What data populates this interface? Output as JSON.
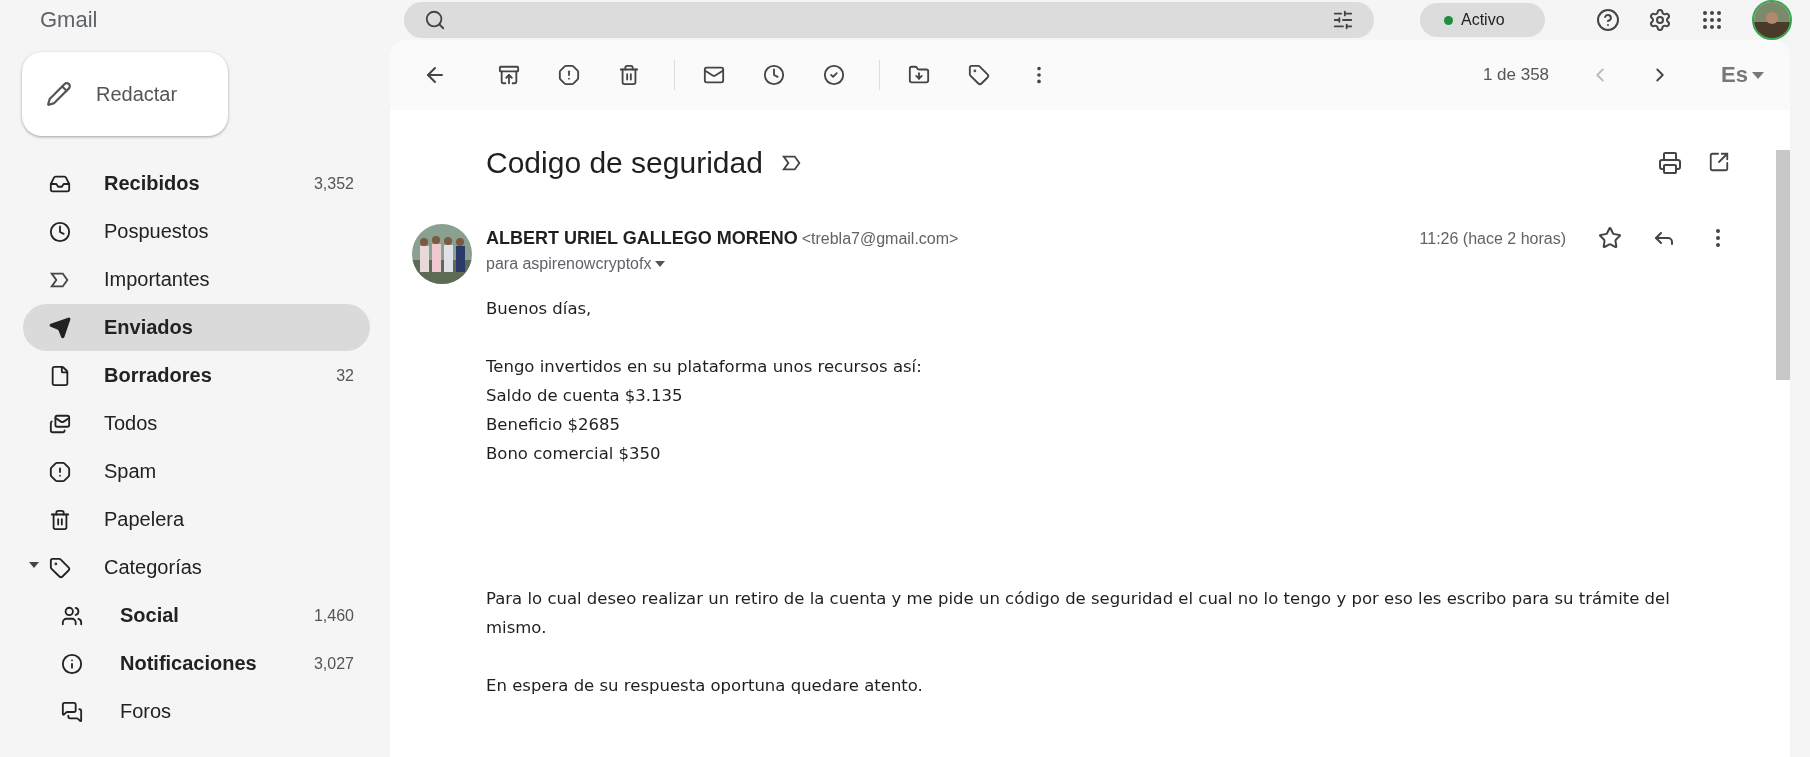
{
  "header": {
    "logo": "Gmail",
    "status": {
      "label": "Activo",
      "color": "#1e8e3e"
    }
  },
  "compose": {
    "label": "Redactar"
  },
  "sidebar": {
    "items": [
      {
        "label": "Recibidos",
        "count": "3,352",
        "bold": true,
        "selected": false
      },
      {
        "label": "Pospuestos",
        "bold": false,
        "selected": false
      },
      {
        "label": "Importantes",
        "bold": false,
        "selected": false
      },
      {
        "label": "Enviados",
        "bold": true,
        "selected": true
      },
      {
        "label": "Borradores",
        "count": "32",
        "bold": true,
        "selected": false
      },
      {
        "label": "Todos",
        "bold": false,
        "selected": false
      },
      {
        "label": "Spam",
        "bold": false,
        "selected": false
      },
      {
        "label": "Papelera",
        "bold": false,
        "selected": false
      },
      {
        "label": "Categorías",
        "bold": false,
        "selected": false,
        "expanded": true,
        "children": [
          {
            "label": "Social",
            "count": "1,460",
            "bold": true,
            "selected": false
          },
          {
            "label": "Notificaciones",
            "count": "3,027",
            "bold": true,
            "selected": false
          },
          {
            "label": "Foros",
            "bold": false,
            "selected": false
          }
        ]
      }
    ]
  },
  "toolbar": {
    "pager": "1 de 358",
    "prev_disabled": true,
    "input_tools": "Es"
  },
  "email": {
    "subject": "Codigo de seguridad",
    "sender": "ALBERT URIEL GALLEGO MORENO",
    "address": "<trebla7@gmail.com>",
    "to": "para aspirenowcryptofx",
    "time": "11:26 (hace 2 horas)",
    "starred": false,
    "paragraphs": [
      [
        "Buenos días,"
      ],
      [
        "Tengo invertidos en su plataforma unos recursos así:",
        "Saldo de cuenta $3.135",
        "Beneficio $2685",
        "Bono comercial $350"
      ],
      [
        "Para lo cual deseo realizar un retiro de la cuenta y me pide un código de seguridad el cual no lo tengo y por eso les escribo para su trámite del mismo."
      ],
      [
        "En espera de su respuesta oportuna quedare atento."
      ]
    ]
  }
}
